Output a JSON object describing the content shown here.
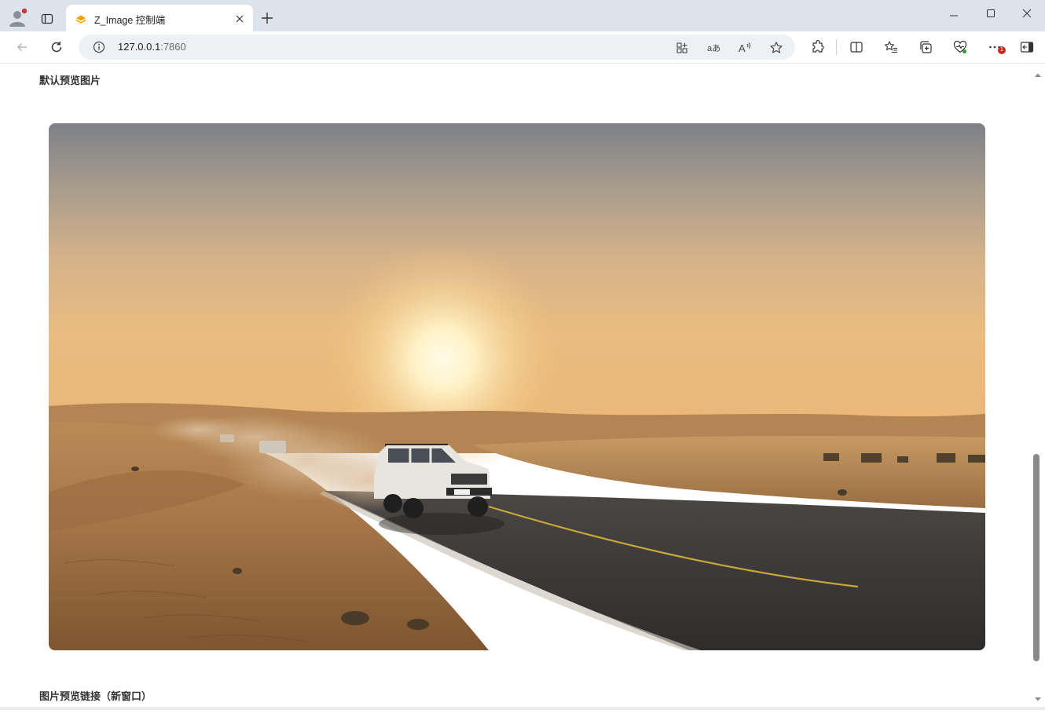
{
  "browser": {
    "tab_title": "Z_Image 控制端",
    "url_host": "127.0.0.1",
    "url_port": ":7860",
    "notification_count": "1",
    "icons": {
      "profile": "profile-icon",
      "tab_actions": "tab-actions-icon",
      "tab_favicon": "gradio-icon",
      "tab_close": "close-icon",
      "new_tab": "plus-icon",
      "back": "back-arrow-icon",
      "reload": "reload-icon",
      "site_info": "info-icon",
      "toolbar": [
        "app-available-icon",
        "translate-icon",
        "read-aloud-icon",
        "favorite-star-icon",
        "extensions-icon",
        "split-screen-icon",
        "favorites-icon",
        "collections-icon",
        "browser-essentials-icon",
        "more-icon",
        "sidebar-icon"
      ]
    }
  },
  "page": {
    "default_preview_label": "默认预览图片",
    "preview_link_label": "图片预览链接（新窗口）"
  },
  "image": {
    "scene": "desert-sunset-suv-road"
  },
  "colors": {
    "titlebar": "#dde3ea",
    "omnibox": "#eef1f4",
    "badge": "#c42b1c",
    "scroll_thumb": "#8a8a8a"
  }
}
